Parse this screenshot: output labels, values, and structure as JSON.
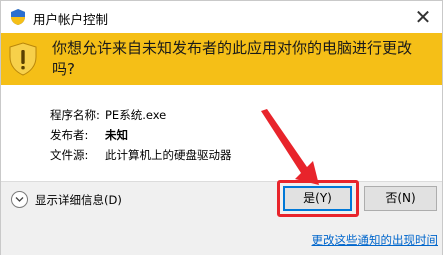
{
  "window": {
    "title": "用户帐户控制",
    "close_glyph": "✕"
  },
  "banner": {
    "question": "你想允许来自未知发布者的此应用对你的电脑进行更改吗?",
    "background": "#f5bf17"
  },
  "details": {
    "rows": [
      {
        "label": "程序名称:",
        "value": "PE系统.exe"
      },
      {
        "label": "发布者:",
        "value": "未知"
      },
      {
        "label": "文件源:",
        "value": "此计算机上的硬盘驱动器"
      }
    ]
  },
  "footer": {
    "show_details_label": "显示详细信息(D)",
    "yes_label": "是(Y)",
    "no_label": "否(N)",
    "change_link": "更改这些通知的出现时间"
  },
  "colors": {
    "accent": "#0078d7",
    "annotation": "#e8242b",
    "link": "#0066cc"
  },
  "icons": [
    "uac-shield-icon",
    "close-icon",
    "warning-shield-icon",
    "chevron-down-icon",
    "annotation-arrow"
  ]
}
